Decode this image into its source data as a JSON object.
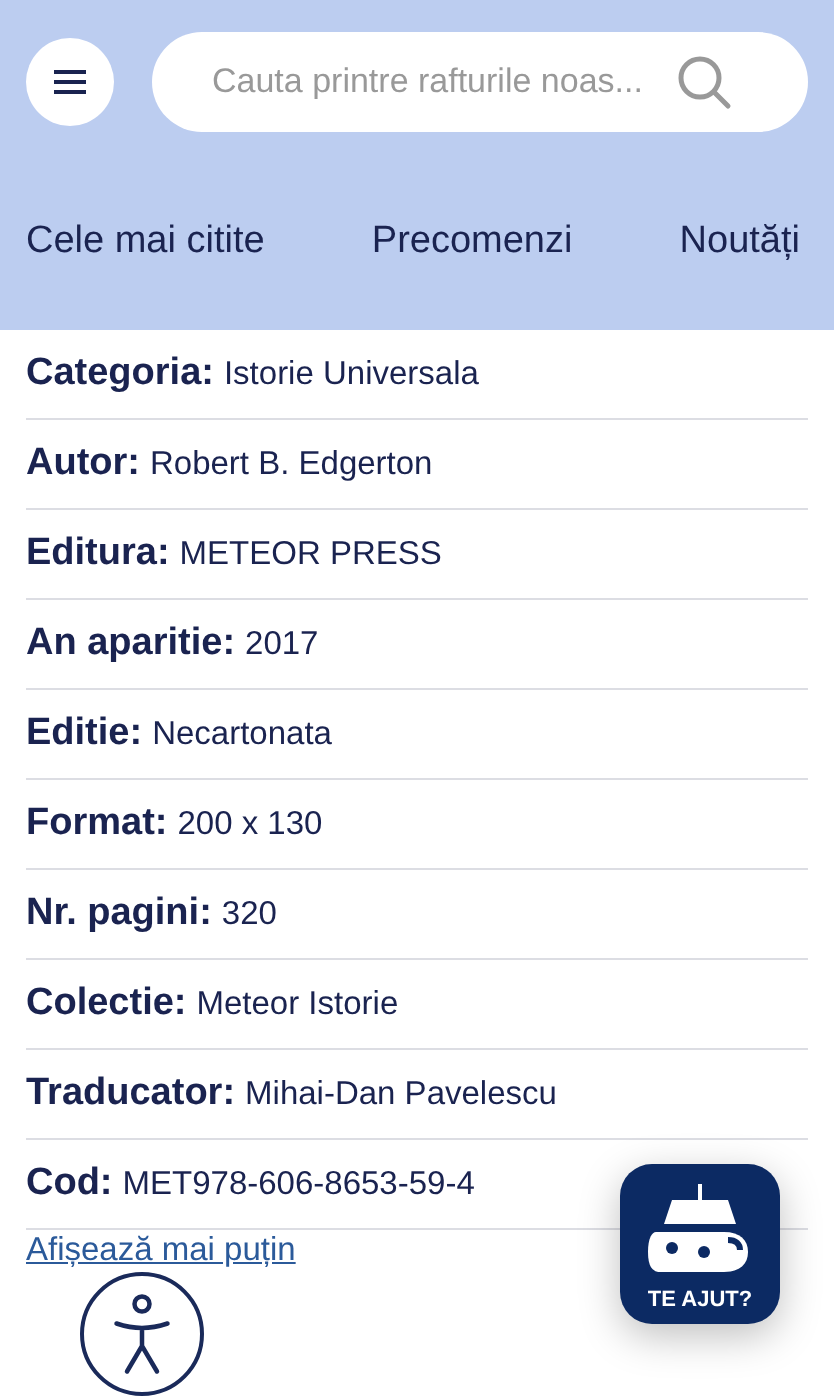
{
  "search": {
    "placeholder": "Cauta printre rafturile noas..."
  },
  "tabs": [
    {
      "label": "Cele mai citite"
    },
    {
      "label": "Precomenzi"
    },
    {
      "label": "Noutăți"
    }
  ],
  "details": [
    {
      "label": "Categoria:",
      "value": "Istorie Universala"
    },
    {
      "label": "Autor:",
      "value": "Robert B. Edgerton"
    },
    {
      "label": "Editura:",
      "value": "METEOR PRESS"
    },
    {
      "label": "An aparitie:",
      "value": "2017"
    },
    {
      "label": "Editie:",
      "value": "Necartonata"
    },
    {
      "label": "Format:",
      "value": "200 x 130"
    },
    {
      "label": "Nr. pagini:",
      "value": "320"
    },
    {
      "label": "Colectie:",
      "value": "Meteor Istorie"
    },
    {
      "label": "Traducator:",
      "value": "Mihai-Dan Pavelescu"
    },
    {
      "label": "Cod:",
      "value": "MET978-606-8653-59-4"
    }
  ],
  "toggle_link": "Afișează mai puțin",
  "chat_widget": {
    "label": "TE AJUT?"
  }
}
